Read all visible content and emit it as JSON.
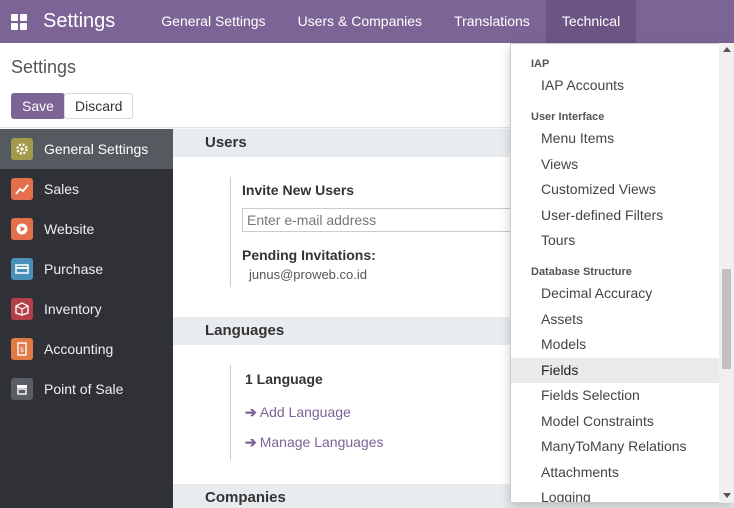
{
  "navbar": {
    "apps_icon": "grid-icon",
    "brand": "Settings",
    "menu": [
      {
        "label": "General Settings"
      },
      {
        "label": "Users & Companies"
      },
      {
        "label": "Translations"
      },
      {
        "label": "Technical"
      }
    ]
  },
  "control_panel": {
    "title": "Settings",
    "save_label": "Save",
    "discard_label": "Discard"
  },
  "sidebar": {
    "items": [
      {
        "label": "General Settings",
        "icon": "gear-icon",
        "color": "#a29b4c"
      },
      {
        "label": "Sales",
        "icon": "chart-icon",
        "color": "#e46f4c"
      },
      {
        "label": "Website",
        "icon": "globe-icon",
        "color": "#e46f4c"
      },
      {
        "label": "Purchase",
        "icon": "card-icon",
        "color": "#4a90b8"
      },
      {
        "label": "Inventory",
        "icon": "box-icon",
        "color": "#b33f47"
      },
      {
        "label": "Accounting",
        "icon": "invoice-icon",
        "color": "#e07b45"
      },
      {
        "label": "Point of Sale",
        "icon": "store-icon",
        "color": "#5a5d63"
      }
    ]
  },
  "main": {
    "users_heading": "Users",
    "invite_label": "Invite New Users",
    "email_placeholder": "Enter e-mail address",
    "pending_label": "Pending Invitations:",
    "pending_email": "junus@proweb.co.id",
    "languages_heading": "Languages",
    "language_count": "1 Language",
    "add_language": "Add Language",
    "manage_languages": "Manage Languages",
    "companies_heading": "Companies"
  },
  "dropdown": {
    "headers": {
      "iap": "IAP",
      "ui": "User Interface",
      "db": "Database Structure"
    },
    "iap_items": [
      "IAP Accounts"
    ],
    "ui_items": [
      "Menu Items",
      "Views",
      "Customized Views",
      "User-defined Filters",
      "Tours"
    ],
    "db_items": [
      "Decimal Accuracy",
      "Assets",
      "Models",
      "Fields",
      "Fields Selection",
      "Model Constraints",
      "ManyToMany Relations",
      "Attachments",
      "Logging"
    ],
    "highlighted": "Fields"
  },
  "colors": {
    "brand": "#7c6596",
    "sidebar_bg": "#2f3136",
    "sidebar_active": "#555960"
  }
}
